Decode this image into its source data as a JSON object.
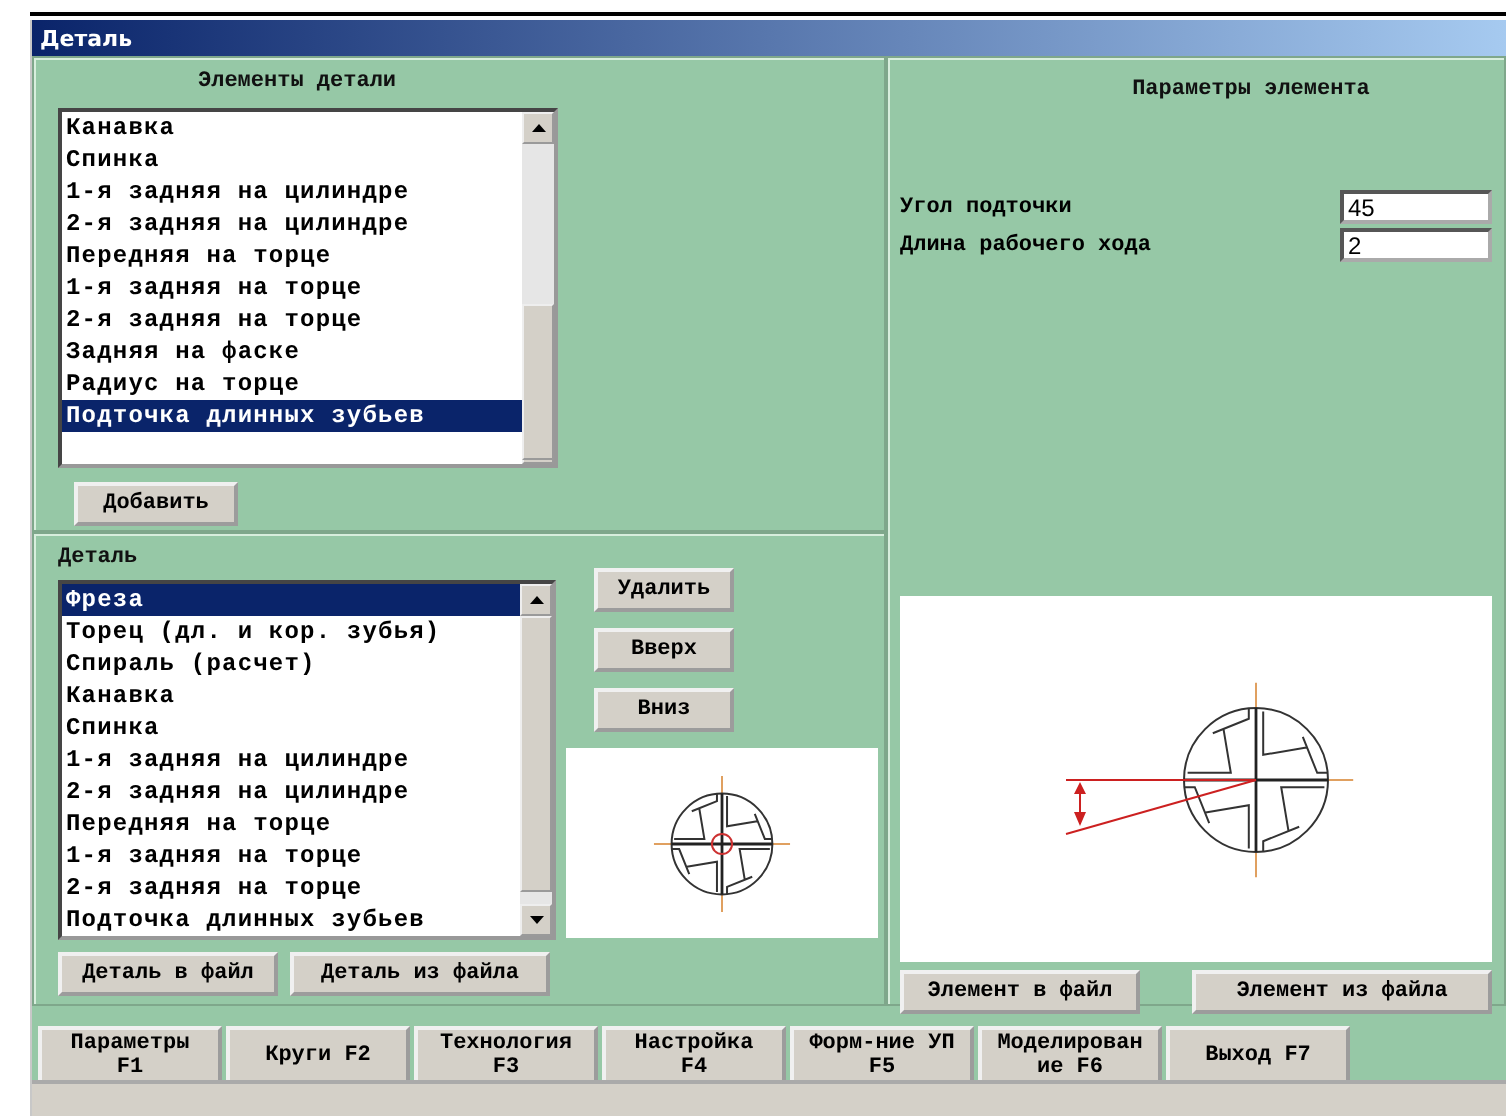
{
  "window": {
    "title": "Деталь"
  },
  "elements_panel": {
    "title": "Элементы детали",
    "items": [
      {
        "label": "Канавка",
        "selected": false
      },
      {
        "label": "Спинка",
        "selected": false
      },
      {
        "label": "1-я задняя на цилиндре",
        "selected": false
      },
      {
        "label": "2-я задняя на цилиндре",
        "selected": false
      },
      {
        "label": "Передняя на торце",
        "selected": false
      },
      {
        "label": "1-я задняя на торце",
        "selected": false
      },
      {
        "label": "2-я задняя на торце",
        "selected": false
      },
      {
        "label": "Задняя на фаске",
        "selected": false
      },
      {
        "label": "Радиус на торце",
        "selected": false
      },
      {
        "label": "Подточка длинных зубьев",
        "selected": true
      }
    ],
    "add_button": "Добавить"
  },
  "detail_panel": {
    "title": "Деталь",
    "items": [
      {
        "label": "Фреза",
        "selected": true
      },
      {
        "label": "Торец (дл. и кор. зубья)",
        "selected": false
      },
      {
        "label": "Спираль (расчет)",
        "selected": false
      },
      {
        "label": "Канавка",
        "selected": false
      },
      {
        "label": "Спинка",
        "selected": false
      },
      {
        "label": "1-я задняя на цилиндре",
        "selected": false
      },
      {
        "label": "2-я задняя на цилиндре",
        "selected": false
      },
      {
        "label": "Передняя на торце",
        "selected": false
      },
      {
        "label": "1-я задняя на торце",
        "selected": false
      },
      {
        "label": "2-я задняя на торце",
        "selected": false
      },
      {
        "label": "Подточка длинных зубьев",
        "selected": false
      }
    ],
    "buttons": [
      "Удалить",
      "Вверх",
      "Вниз"
    ],
    "file_buttons": [
      "Деталь в файл",
      "Деталь из файла"
    ]
  },
  "params_panel": {
    "title": "Параметры элемента",
    "fields": [
      {
        "label": "Угол подточки",
        "value": "45"
      },
      {
        "label": "Длина рабочего хода",
        "value": "2"
      }
    ],
    "file_buttons": [
      "Элемент в файл",
      "Элемент из файла"
    ]
  },
  "tabs": [
    {
      "lines": [
        "Параметры",
        "F1"
      ]
    },
    {
      "lines": [
        "Круги F2"
      ]
    },
    {
      "lines": [
        "Технология",
        "F3"
      ]
    },
    {
      "lines": [
        "Настройка",
        "F4"
      ]
    },
    {
      "lines": [
        "Форм-ние УП",
        "F5"
      ]
    },
    {
      "lines": [
        "Моделирован",
        "ие F6"
      ]
    },
    {
      "lines": [
        "Выход F7"
      ]
    }
  ]
}
